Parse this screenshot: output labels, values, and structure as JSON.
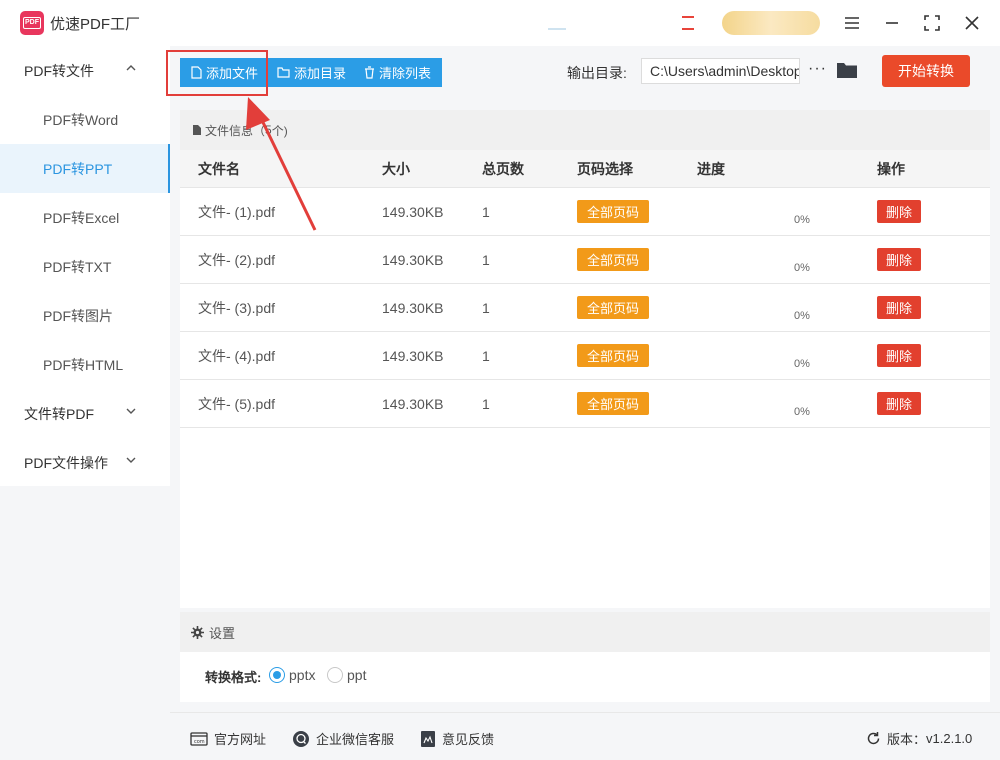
{
  "app": {
    "title": "优速PDF工厂",
    "logo_text": "PDF"
  },
  "window": {
    "menu_icon": "menu-icon",
    "minimize_icon": "minimize-icon",
    "maximize_icon": "maximize-icon",
    "close_icon": "close-icon"
  },
  "sidebar": {
    "groups": [
      {
        "label": "PDF转文件",
        "expanded": true
      },
      {
        "label": "文件转PDF",
        "expanded": false
      },
      {
        "label": "PDF文件操作",
        "expanded": false
      }
    ],
    "items": [
      {
        "label": "PDF转Word"
      },
      {
        "label": "PDF转PPT",
        "active": true
      },
      {
        "label": "PDF转Excel"
      },
      {
        "label": "PDF转TXT"
      },
      {
        "label": "PDF转图片"
      },
      {
        "label": "PDF转HTML"
      }
    ]
  },
  "toolbar": {
    "add_file": "添加文件",
    "add_folder": "添加目录",
    "clear_list": "清除列表",
    "output_label": "输出目录:",
    "output_path": "C:\\Users\\admin\\Desktop",
    "more": "···",
    "start": "开始转换"
  },
  "files": {
    "header_prefix": "文件信息（",
    "count": "5",
    "header_suffix": " 个)",
    "columns": [
      "文件名",
      "大小",
      "总页数",
      "页码选择",
      "进度",
      "操作"
    ],
    "rows": [
      {
        "name": "文件- (1).pdf",
        "size": "149.30KB",
        "pages": "1",
        "range": "全部页码",
        "progress": 0,
        "progress_text": "0%",
        "action": "删除"
      },
      {
        "name": "文件- (2).pdf",
        "size": "149.30KB",
        "pages": "1",
        "range": "全部页码",
        "progress": 0,
        "progress_text": "0%",
        "action": "删除"
      },
      {
        "name": "文件- (3).pdf",
        "size": "149.30KB",
        "pages": "1",
        "range": "全部页码",
        "progress": 0,
        "progress_text": "0%",
        "action": "删除"
      },
      {
        "name": "文件- (4).pdf",
        "size": "149.30KB",
        "pages": "1",
        "range": "全部页码",
        "progress": 0,
        "progress_text": "0%",
        "action": "删除"
      },
      {
        "name": "文件- (5).pdf",
        "size": "149.30KB",
        "pages": "1",
        "range": "全部页码",
        "progress": 0,
        "progress_text": "0%",
        "action": "删除"
      }
    ]
  },
  "settings": {
    "title": "设置",
    "format_label": "转换格式:",
    "options": [
      {
        "label": "pptx",
        "selected": true
      },
      {
        "label": "ppt",
        "selected": false
      }
    ]
  },
  "footer": {
    "website": "官方网址",
    "wechat": "企业微信客服",
    "feedback": "意见反馈",
    "version_label": "版本：",
    "version": "v1.2.1.0"
  },
  "colors": {
    "accent": "#2b9de6",
    "start": "#ea4a2a",
    "range": "#f29a19",
    "delete": "#e2402e",
    "annotation": "#e23e3a"
  }
}
